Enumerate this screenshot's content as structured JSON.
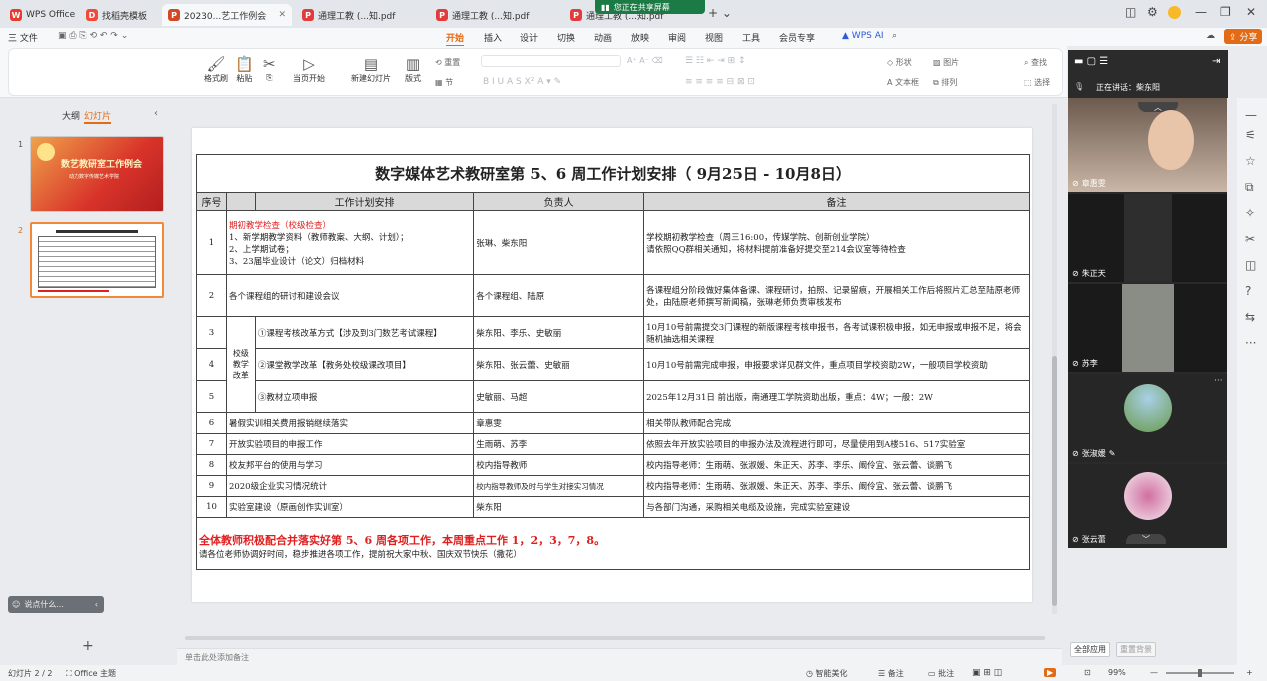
{
  "tabs": [
    {
      "label": "WPS Office",
      "icon": "wps-logo-icon",
      "color": "#e63b2e"
    },
    {
      "label": "找稻壳模板",
      "icon": "docer-icon",
      "color": "#f04a3a"
    },
    {
      "label": "20230...艺工作例会",
      "icon": "presentation-icon",
      "color": "#d24726"
    },
    {
      "label": "通理工教 (...知.pdf",
      "icon": "pdf-icon",
      "color": "#e23b3b"
    },
    {
      "label": "通理工教 (...知.pdf",
      "icon": "pdf-icon",
      "color": "#e23b3b"
    },
    {
      "label": "通理工教 (...知.pdf",
      "icon": "pdf-icon",
      "color": "#e23b3b"
    }
  ],
  "share_banner": "您正在共享屏幕",
  "menu": {
    "file": "三 文件",
    "items": [
      "开始",
      "插入",
      "设计",
      "切换",
      "动画",
      "放映",
      "审阅",
      "视图",
      "工具",
      "会员专享"
    ],
    "wps_ai": "WPS AI",
    "share_btn": "分享"
  },
  "ribbon": {
    "format_painter": "格式刷",
    "paste": "粘贴",
    "play": "当页开始",
    "new_slide": "新建幻灯片",
    "layout": "版式",
    "section": "节",
    "reset": "重置",
    "shape": "形状",
    "picture": "图片",
    "textbox": "文本框",
    "arrange": "排列",
    "find": "查找",
    "select": "选择"
  },
  "left_panel": {
    "tab_outline": "大纲",
    "tab_slides": "幻灯片",
    "slide1_title": "数艺教研室工作例会",
    "slide1_sub": "动力数字传媒艺术学院",
    "slide_numbers": [
      "1",
      "2"
    ],
    "comment_placeholder": "说点什么...",
    "add": "+"
  },
  "slide": {
    "title": "数字媒体艺术教研室第 5、6 周工作计划安排（ 9月25日 - 10月8日）",
    "headers": [
      "序号",
      "工作计划安排",
      "负责人",
      "备注"
    ],
    "group_label": "校级教学改革",
    "rows": [
      {
        "no": "1",
        "plan_red": "期初教学检查（校级检查）",
        "plan": "1、新学期教学资料（教师教案、大纲、计划）；\n2、上学期试卷；\n3、23届毕业设计（论文）归档材料",
        "owner": "张琳、柴东阳",
        "note": "学校期初教学检查（周三16:00，传媒学院、创新创业学院）\n请依照QQ群相关通知，将材料提前准备好提交至214会议室等待检查"
      },
      {
        "no": "2",
        "plan": "各个课程组的研讨和建设会议",
        "owner": "各个课程组、陆原",
        "note": "各课程组分阶段做好集体备课、课程研讨，拍照、记录留痕，开展相关工作后将照片汇总至陆原老师处，由陆原老师撰写新闻稿，张琳老师负责审核发布"
      },
      {
        "no": "3",
        "plan": "①课程考核改革方式【涉及到3门数艺考试课程】",
        "owner": "柴东阳、李乐、史敏丽",
        "note": "10月10号前需提交3门课程的新版课程考核申报书，各考试课积极申报，如无申报或申报不足，将会随机抽选相关课程"
      },
      {
        "no": "4",
        "plan": "②课堂教学改革【教务处校级课改项目】",
        "owner": "柴东阳、张云蕾、史敏丽",
        "note": "10月10号前需完成申报，申报要求详见群文件，重点项目学校资助2W，一般项目学校资助"
      },
      {
        "no": "5",
        "plan": "③教材立项申报",
        "owner": "史敏丽、马超",
        "note": "2025年12月31日 前出版，南通理工学院资助出版，重点：4W；一般：2W"
      },
      {
        "no": "6",
        "plan": "暑假实训相关费用报销继续落实",
        "owner": "章惠雯",
        "note": "相关带队教师配合完成"
      },
      {
        "no": "7",
        "plan": "开放实验项目的申报工作",
        "owner": "生雨萌、苏李",
        "note": "依照去年开放实验项目的申报办法及流程进行即可，尽量使用到A楼516、517实验室"
      },
      {
        "no": "8",
        "plan": "校友邦平台的使用与学习",
        "owner": "校内指导教师",
        "note": "校内指导老师：生雨萌、张淑媛、朱正天、苏李、李乐、阚伶宜、张云蕾、谈鹏飞"
      },
      {
        "no": "9",
        "plan": "2020级企业实习情况统计",
        "owner": "校内指导教师及时与学生对接实习情况",
        "note": "校内指导老师：生雨萌、张淑媛、朱正天、苏李、李乐、阚伶宜、张云蕾、谈鹏飞"
      },
      {
        "no": "10",
        "plan": "实验室建设（原画创作实训室）",
        "owner": "柴东阳",
        "note": "与各部门沟通，采购相关电缆及设施，完成实验室建设"
      }
    ],
    "footer_red": "全体教师积极配合并落实好第 5、6 周各项工作，本周重点工作 1，2，3，7，8。",
    "footer_note": "请各位老师协调好时间，稳步推进各项工作，提前祝大家中秋、国庆双节快乐（撒花）"
  },
  "notes_placeholder": "单击此处添加备注",
  "meeting": {
    "speaking": "正在讲话：柴东阳",
    "participants": [
      "章惠雯",
      "朱正天",
      "苏李",
      "张淑媛",
      "张云蕾"
    ],
    "btn_apply_all": "全部应用",
    "btn_reset_bg": "重置背景"
  },
  "status": {
    "slide_counter": "幻灯片 2 / 2",
    "theme": "Office 主题",
    "smart": "智能美化",
    "notes": "备注",
    "comments": "批注",
    "zoom": "99%"
  }
}
